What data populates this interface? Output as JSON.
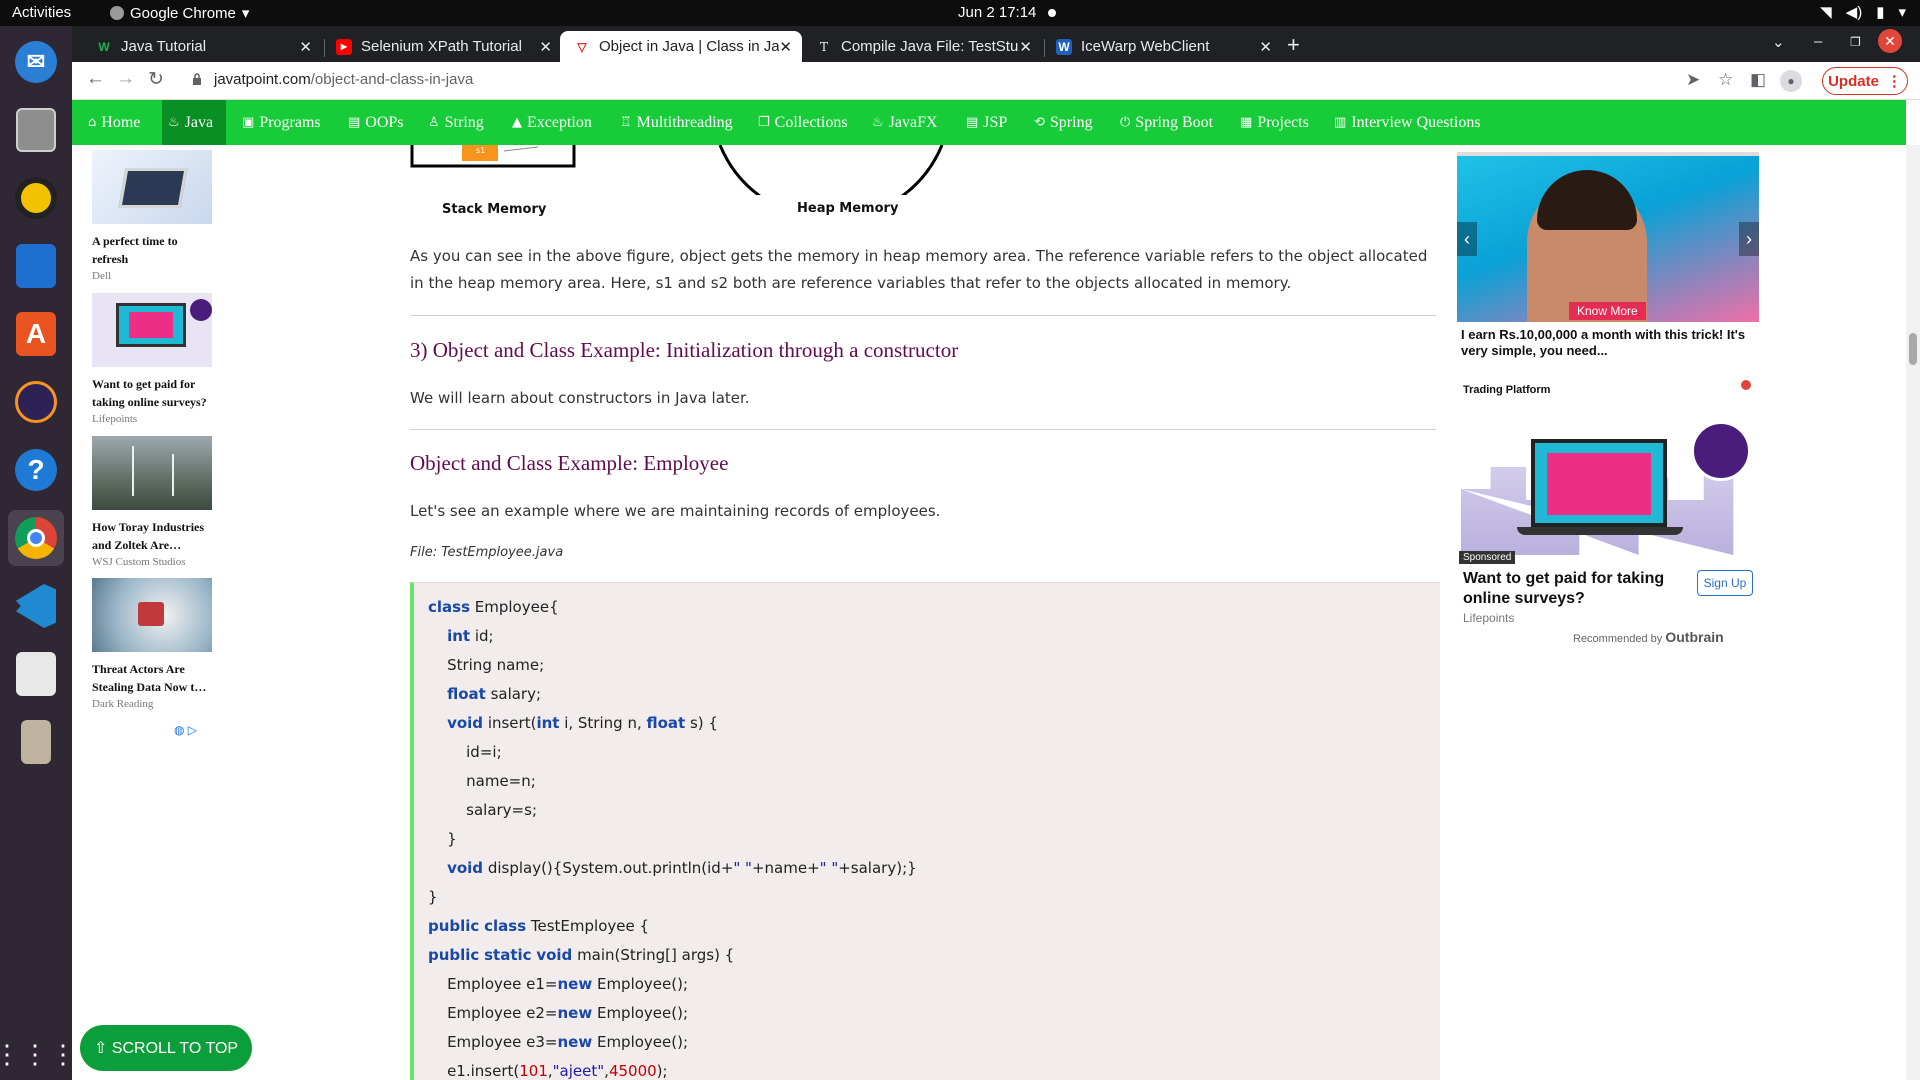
{
  "system_bar": {
    "activities": "Activities",
    "app_name": "Google Chrome",
    "clock": "Jun 2  17:14"
  },
  "dock": {
    "items": [
      "thunderbird-icon",
      "files-icon",
      "rhythmbox-icon",
      "writer-icon",
      "app-center-icon",
      "eclipse-icon",
      "help-icon",
      "chrome-icon",
      "vscode-icon",
      "java-duke-icon",
      "archive-icon",
      "show-apps-icon"
    ]
  },
  "tabs": [
    {
      "title": "Java Tutorial",
      "favicon": "W"
    },
    {
      "title": "Selenium XPath Tutorial",
      "favicon": "▶"
    },
    {
      "title": "Object in Java | Class in Ja",
      "favicon": "▽"
    },
    {
      "title": "Compile Java File: TestStu",
      "favicon": "T"
    },
    {
      "title": "IceWarp WebClient",
      "favicon": "W"
    }
  ],
  "omnibox": {
    "domain": "javatpoint.com",
    "path": "/object-and-class-in-java",
    "update_label": "Update"
  },
  "site_nav": [
    {
      "label": "Home",
      "icon": "home-icon",
      "glyph": "⌂"
    },
    {
      "label": "Java",
      "icon": "java-icon",
      "glyph": "♨"
    },
    {
      "label": "Programs",
      "icon": "programs-icon",
      "glyph": "▣"
    },
    {
      "label": "OOPs",
      "icon": "oops-icon",
      "glyph": "▤"
    },
    {
      "label": "String",
      "icon": "string-icon",
      "glyph": "♙"
    },
    {
      "label": "Exception",
      "icon": "exception-icon",
      "glyph": "▲"
    },
    {
      "label": "Multithreading",
      "icon": "multithreading-icon",
      "glyph": "♖"
    },
    {
      "label": "Collections",
      "icon": "collections-icon",
      "glyph": "❐"
    },
    {
      "label": "JavaFX",
      "icon": "javafx-icon",
      "glyph": "♨"
    },
    {
      "label": "JSP",
      "icon": "jsp-icon",
      "glyph": "▤"
    },
    {
      "label": "Spring",
      "icon": "spring-icon",
      "glyph": "⟲"
    },
    {
      "label": "Spring Boot",
      "icon": "spring-boot-icon",
      "glyph": "⏻"
    },
    {
      "label": "Projects",
      "icon": "projects-icon",
      "glyph": "▦"
    },
    {
      "label": "Interview Questions",
      "icon": "interview-icon",
      "glyph": "▥"
    }
  ],
  "left_ads": [
    {
      "title": "A perfect time to refresh",
      "source": "Dell"
    },
    {
      "title": "Want to get paid for taking online surveys?",
      "source": "Lifepoints"
    },
    {
      "title": "How Toray Industries and Zoltek Are…",
      "source": "WSJ Custom Studios"
    },
    {
      "title": "Threat Actors Are Stealing Data Now t…",
      "source": "Dark Reading"
    }
  ],
  "figure": {
    "stack_label": "Stack Memory",
    "heap_label": "Heap Memory",
    "s1_label": "s1"
  },
  "content": {
    "para1": "As you can see in the above figure, object gets the memory in heap memory area. The reference variable refers to the object allocated in the heap memory area. Here, s1 and s2 both are reference variables that refer to the objects allocated in memory.",
    "heading1": "3) Object and Class Example: Initialization through a constructor",
    "para2": "We will learn about constructors in Java later.",
    "heading2": "Object and Class Example: Employee",
    "para3": "Let's see an example where we are maintaining records of employees.",
    "file_label": "File: TestEmployee.java"
  },
  "code_lines": [
    "class Employee{",
    "    int id;",
    "    String name;",
    "    float salary;",
    "    void insert(int i, String n, float s) {",
    "        id=i;",
    "        name=n;",
    "        salary=s;",
    "    }",
    "    void display(){System.out.println(id+\" \"+name+\" \"+salary);}",
    "}",
    "public class TestEmployee {",
    "public static void main(String[] args) {",
    "    Employee e1=new Employee();",
    "    Employee e2=new Employee();",
    "    Employee e3=new Employee();",
    "    e1.insert(101,\"ajeet\",45000);"
  ],
  "right_ad1": {
    "cta": "Know More",
    "text": "I earn Rs.10,00,000 a month with this trick! It's very simple, you need...",
    "brand": "Trading Platform"
  },
  "right_ad2": {
    "sponsored": "Sponsored",
    "text": "Want to get paid for taking online surveys?",
    "source": "Lifepoints",
    "signup": "Sign Up",
    "recommended": "Recommended by",
    "recommender": "Outbrain"
  },
  "scroll_to_top": "⇧ SCROLL TO TOP",
  "colors": {
    "site_green": "#18cc39",
    "heading_maroon": "#610b4b",
    "code_bg": "#f3ecec",
    "keyword_blue": "#1848a8"
  }
}
